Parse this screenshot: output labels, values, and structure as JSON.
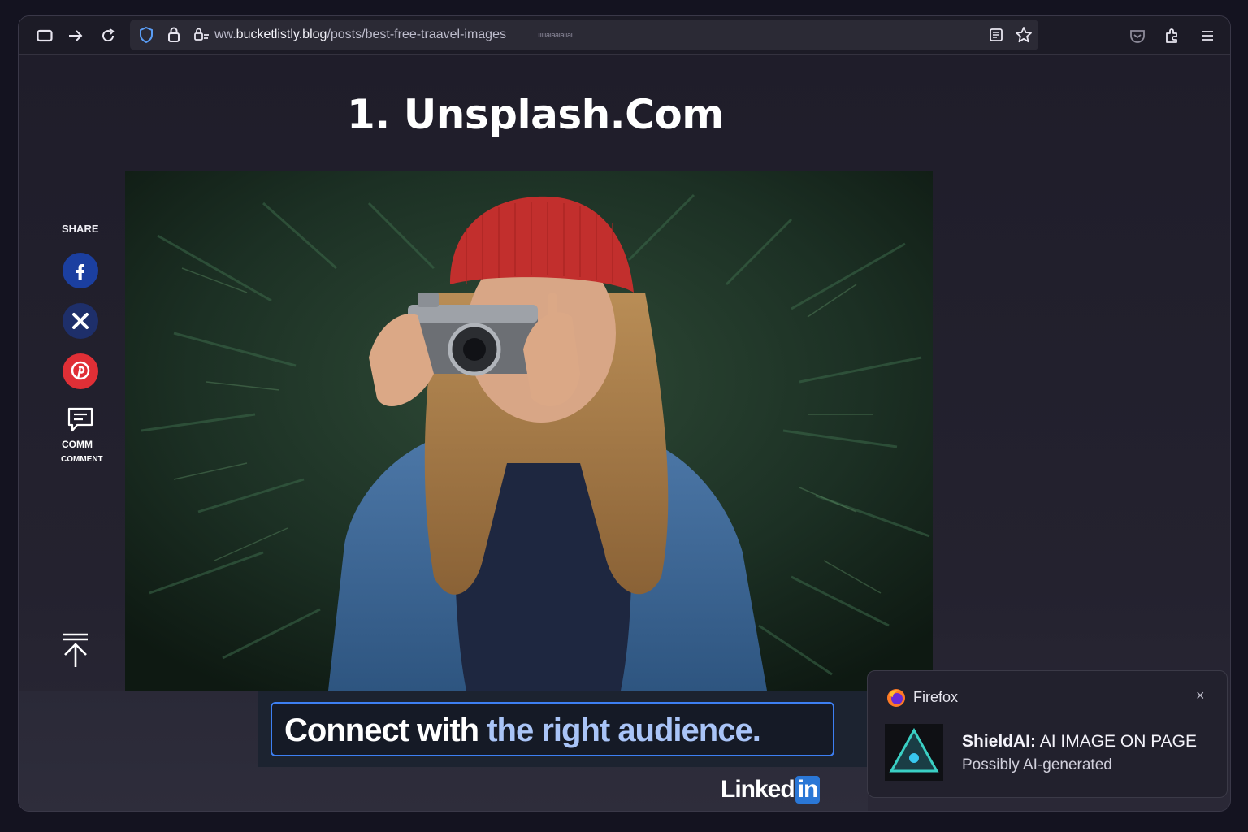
{
  "browser": {
    "url_prefix": "ww.",
    "url_domain": "bucketlistly.blog",
    "url_path": "/posts/best-free-traavel-images",
    "url_suffix": "ıııııaıaaıaııaı"
  },
  "article": {
    "heading": "1. Unsplash.Com"
  },
  "share": {
    "label": "SHARE",
    "comment_label_top": "COMM",
    "comment_label_bottom": "COMMENT",
    "facebook_color": "#1b3fa0",
    "x_color": "#1e2f6a",
    "pinterest_color": "#e02f36"
  },
  "ad": {
    "text_start": "Connect with ",
    "text_highlight": "the right audience.",
    "brand_main": "Linked",
    "brand_box": "in"
  },
  "notification": {
    "app_name": "Firefox",
    "close_glyph": "×",
    "title_brand": "ShieldAI:",
    "title_rest": " AI IMAGE ON PAGE",
    "subtitle": "Possibly AI-generated"
  }
}
